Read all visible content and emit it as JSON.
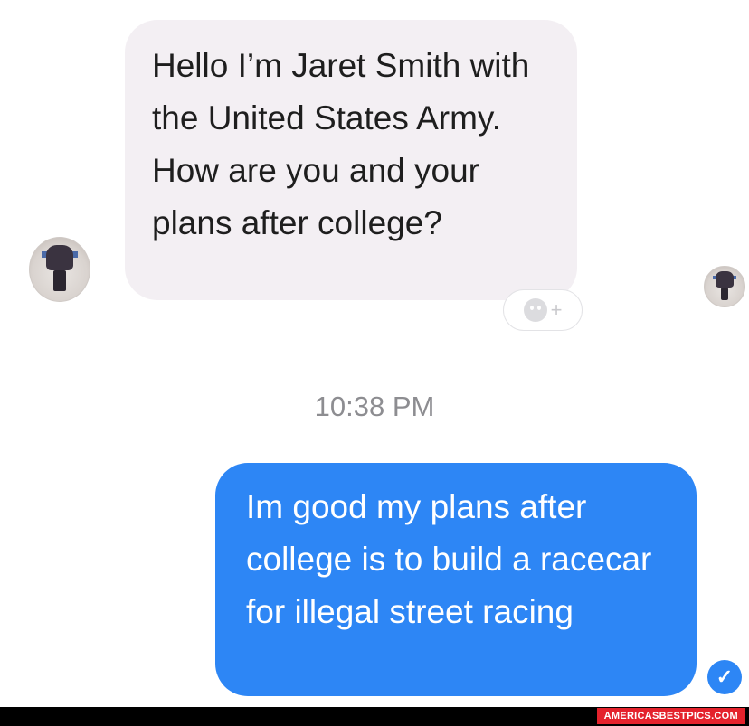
{
  "conversation": {
    "received_message": "Hello I’m Jaret Smith with the United States Army. How are you and your plans after college?",
    "timestamp": "10:38 PM",
    "sent_message": "Im good my plans after college is to build a racecar for illegal street racing"
  },
  "icons": {
    "reaction": "add-reaction-icon",
    "read_receipt": "checkmark-icon",
    "plus": "+",
    "check": "✓"
  },
  "watermark": "AMERICASBESTPICS.COM",
  "colors": {
    "sent_bubble": "#2d86f5",
    "received_bubble": "#f3eff3",
    "timestamp_text": "#8d8d91",
    "watermark_tag": "#e4222c"
  }
}
